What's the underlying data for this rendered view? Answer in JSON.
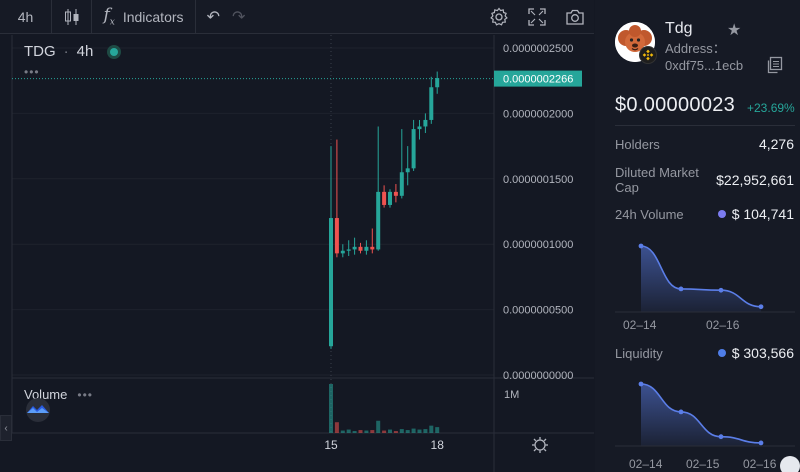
{
  "toolbar": {
    "interval": "4h",
    "indicators_label": "Indicators",
    "icons": [
      "candles-icon",
      "function-icon",
      "undo-icon",
      "redo-icon",
      "settings-icon",
      "fullscreen-icon",
      "camera-icon"
    ]
  },
  "chart": {
    "symbol": "TDG",
    "separator": "·",
    "interval": "4h",
    "more": "•••",
    "volume_label": "Volume",
    "volume_more": "•••",
    "current_price_label": "0.0000002266",
    "volume_scale_label": "1M",
    "collapse_glyph": "‹"
  },
  "chart_data": {
    "type": "candlestick",
    "y_ticks": [
      "0.0000002500",
      "0.0000002000",
      "0.0000001500",
      "0.0000001000",
      "0.0000000500",
      "0.0000000000"
    ],
    "ylim": [
      0,
      2.5e-07
    ],
    "x_ticks": [
      {
        "label": "15",
        "index": 0
      },
      {
        "label": "18",
        "index": 18
      }
    ],
    "current_price": 2.266e-07,
    "up_color": "#26a69a",
    "down_color": "#ef5350",
    "candles": [
      {
        "o": 2.2e-08,
        "h": 1.75e-07,
        "l": 2e-08,
        "c": 1.2e-07
      },
      {
        "o": 1.2e-07,
        "h": 1.8e-07,
        "l": 9e-08,
        "c": 9.3e-08
      },
      {
        "o": 9.3e-08,
        "h": 1e-07,
        "l": 9e-08,
        "c": 9.5e-08
      },
      {
        "o": 9.5e-08,
        "h": 1.03e-07,
        "l": 9.1e-08,
        "c": 9.6e-08
      },
      {
        "o": 9.6e-08,
        "h": 1.05e-07,
        "l": 9.2e-08,
        "c": 9.8e-08
      },
      {
        "o": 9.8e-08,
        "h": 1.01e-07,
        "l": 9.3e-08,
        "c": 9.5e-08
      },
      {
        "o": 9.5e-08,
        "h": 1.03e-07,
        "l": 9.2e-08,
        "c": 9.8e-08
      },
      {
        "o": 9.8e-08,
        "h": 1.12e-07,
        "l": 9.3e-08,
        "c": 9.6e-08
      },
      {
        "o": 9.6e-08,
        "h": 1.9e-07,
        "l": 9.5e-08,
        "c": 1.4e-07
      },
      {
        "o": 1.4e-07,
        "h": 1.45e-07,
        "l": 1.28e-07,
        "c": 1.3e-07
      },
      {
        "o": 1.3e-07,
        "h": 1.42e-07,
        "l": 1.28e-07,
        "c": 1.4e-07
      },
      {
        "o": 1.4e-07,
        "h": 1.46e-07,
        "l": 1.32e-07,
        "c": 1.37e-07
      },
      {
        "o": 1.37e-07,
        "h": 1.88e-07,
        "l": 1.35e-07,
        "c": 1.55e-07
      },
      {
        "o": 1.55e-07,
        "h": 1.75e-07,
        "l": 1.45e-07,
        "c": 1.58e-07
      },
      {
        "o": 1.58e-07,
        "h": 1.95e-07,
        "l": 1.56e-07,
        "c": 1.88e-07
      },
      {
        "o": 1.88e-07,
        "h": 1.95e-07,
        "l": 1.8e-07,
        "c": 1.9e-07
      },
      {
        "o": 1.9e-07,
        "h": 2e-07,
        "l": 1.85e-07,
        "c": 1.95e-07
      },
      {
        "o": 1.95e-07,
        "h": 2.28e-07,
        "l": 1.92e-07,
        "c": 2.2e-07
      },
      {
        "o": 2.2e-07,
        "h": 2.32e-07,
        "l": 2.15e-07,
        "c": 2.27e-07
      }
    ],
    "volume": [
      1.0,
      0.22,
      0.05,
      0.07,
      0.04,
      0.06,
      0.05,
      0.06,
      0.25,
      0.05,
      0.07,
      0.04,
      0.08,
      0.06,
      0.09,
      0.07,
      0.08,
      0.15,
      0.12
    ]
  },
  "token": {
    "name": "Tdg",
    "address_label": "Address：",
    "address": "0xdf75...1ecb",
    "price": "$0.00000023",
    "change": "+23.69%"
  },
  "stats": {
    "holders_label": "Holders",
    "holders_value": "4,276",
    "mcap_label": "Diluted Market Cap",
    "mcap_value": "$22,952,661",
    "volume_label": "24h Volume",
    "volume_value": "$ 104,741",
    "liquidity_label": "Liquidity",
    "liquidity_value": "$ 303,566",
    "volume_dot_color": "#7c7cf0",
    "liquidity_dot_color": "#4f7ee8"
  },
  "mini_volume": {
    "points": [
      1.0,
      0.35,
      0.33,
      0.08
    ],
    "ticks": [
      "02–14",
      "02–16"
    ]
  },
  "mini_liquidity": {
    "points": [
      1.0,
      0.55,
      0.15,
      0.05
    ],
    "ticks": [
      "02–14",
      "02–15",
      "02–16"
    ]
  }
}
